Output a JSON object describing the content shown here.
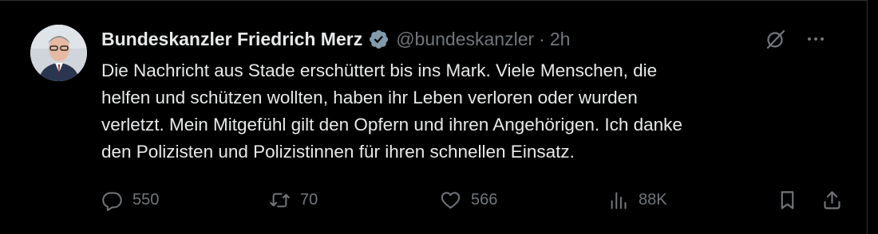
{
  "tweet": {
    "display_name": "Bundeskanzler Friedrich Merz",
    "handle": "@bundeskanzler",
    "separator": "·",
    "time": "2h",
    "text_lines": [
      "Die Nachricht aus Stade erschüttert bis ins Mark. Viele Menschen, die",
      "helfen und schützen wollten, haben ihr Leben verloren oder wurden",
      "verletzt. Mein Mitgefühl gilt den Opfern und ihren Angehörigen. Ich danke",
      "den Polizisten und Polizistinnen für ihren schnellen Einsatz."
    ],
    "verified_badge": "verified-badge-icon",
    "stats": {
      "replies": "550",
      "reposts": "70",
      "likes": "566",
      "views": "88K"
    }
  },
  "icons": {
    "reply": "reply-icon",
    "repost": "repost-icon",
    "like": "heart-icon",
    "views": "views-icon",
    "bookmark": "bookmark-icon",
    "share": "share-icon",
    "grok": "grok-icon",
    "more": "more-icon"
  },
  "colors": {
    "background": "#000000",
    "text_primary": "#e7e9ea",
    "text_secondary": "#71767b",
    "verified": "#829aab"
  }
}
